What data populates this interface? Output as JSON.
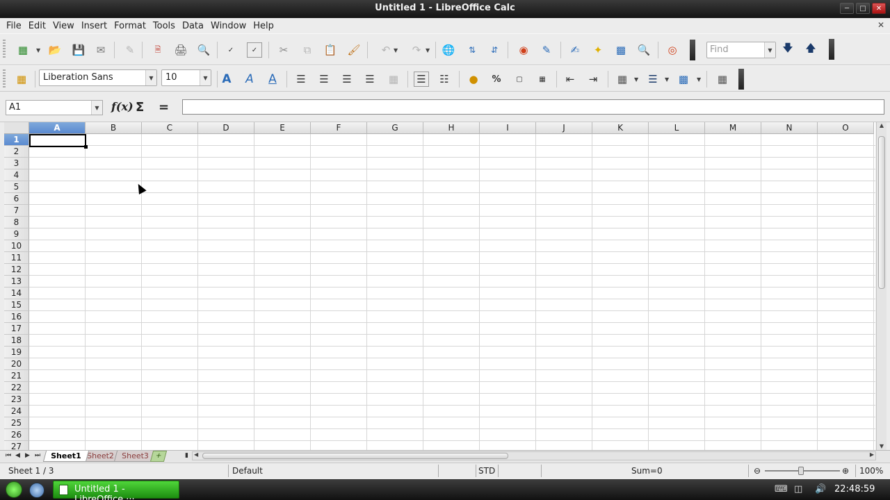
{
  "window": {
    "title": "Untitled 1 - LibreOffice Calc"
  },
  "menu": [
    "File",
    "Edit",
    "View",
    "Insert",
    "Format",
    "Tools",
    "Data",
    "Window",
    "Help"
  ],
  "toolbar": {
    "find_placeholder": "Find",
    "font_name": "Liberation Sans",
    "font_size": "10"
  },
  "formula_bar": {
    "name_box": "A1",
    "formula": ""
  },
  "grid": {
    "columns": [
      "A",
      "B",
      "C",
      "D",
      "E",
      "F",
      "G",
      "H",
      "I",
      "J",
      "K",
      "L",
      "M",
      "N",
      "O"
    ],
    "rows": [
      "1",
      "2",
      "3",
      "4",
      "5",
      "6",
      "7",
      "8",
      "9",
      "10",
      "11",
      "12",
      "13",
      "14",
      "15",
      "16",
      "17",
      "18",
      "19",
      "20",
      "21",
      "22",
      "23",
      "24",
      "25",
      "26",
      "27"
    ],
    "active_cell": "A1"
  },
  "sheets": {
    "tabs": [
      "Sheet1",
      "Sheet2",
      "Sheet3"
    ],
    "active": "Sheet1"
  },
  "status": {
    "sheet_info": "Sheet 1 / 3",
    "page_style": "Default",
    "mode": "STD",
    "sum": "Sum=0",
    "zoom": "100%"
  },
  "taskbar": {
    "task_label": "Untitled 1 - LibreOffice ···",
    "clock": "22:48:59"
  },
  "colors": {
    "accent": "#5a8ad0",
    "taskbar_green": "#2aa51a"
  }
}
